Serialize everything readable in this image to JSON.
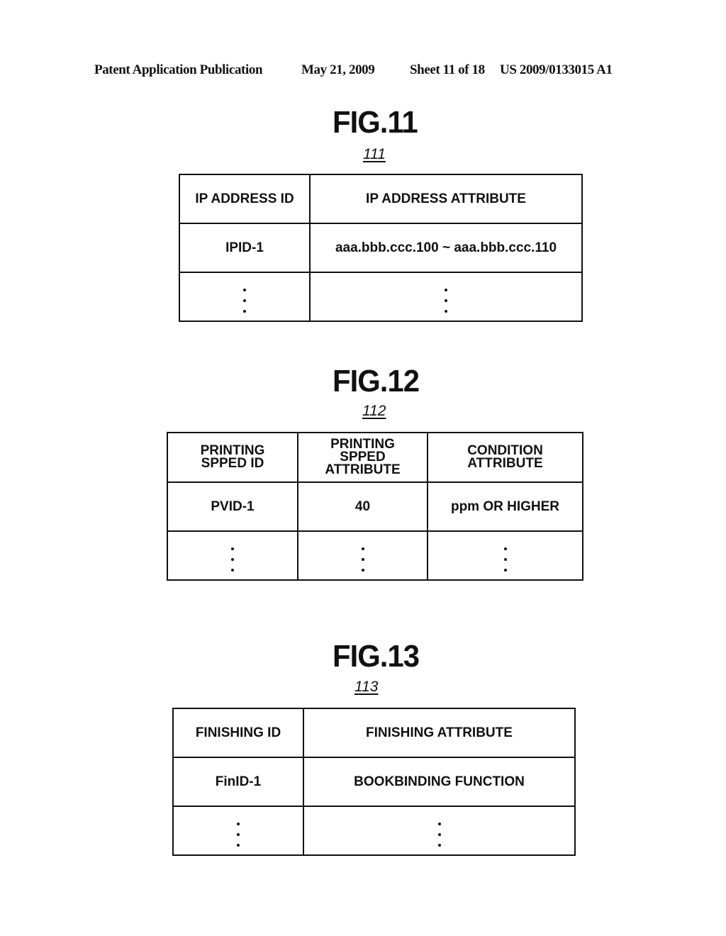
{
  "header": {
    "publication": "Patent Application Publication",
    "date": "May 21, 2009",
    "sheet": "Sheet 11 of 18",
    "number": "US 2009/0133015 A1"
  },
  "figures": [
    {
      "title": "FIG.11",
      "ref": "111",
      "columns": [
        "IP ADDRESS ID",
        "IP ADDRESS ATTRIBUTE"
      ],
      "rows": [
        [
          "IPID-1",
          "aaa.bbb.ccc.100 ~ aaa.bbb.ccc.110"
        ]
      ],
      "continuation": "vertical-ellipsis"
    },
    {
      "title": "FIG.12",
      "ref": "112",
      "columns": [
        "PRINTING\nSPPED ID",
        "PRINTING\nSPPED\nATTRIBUTE",
        "CONDITION\nATTRIBUTE"
      ],
      "rows": [
        [
          "PVID-1",
          "40",
          "ppm OR HIGHER"
        ]
      ],
      "continuation": "vertical-ellipsis"
    },
    {
      "title": "FIG.13",
      "ref": "113",
      "columns": [
        "FINISHING ID",
        "FINISHING ATTRIBUTE"
      ],
      "rows": [
        [
          "FinID-1",
          "BOOKBINDING FUNCTION"
        ]
      ],
      "continuation": "vertical-ellipsis"
    }
  ]
}
